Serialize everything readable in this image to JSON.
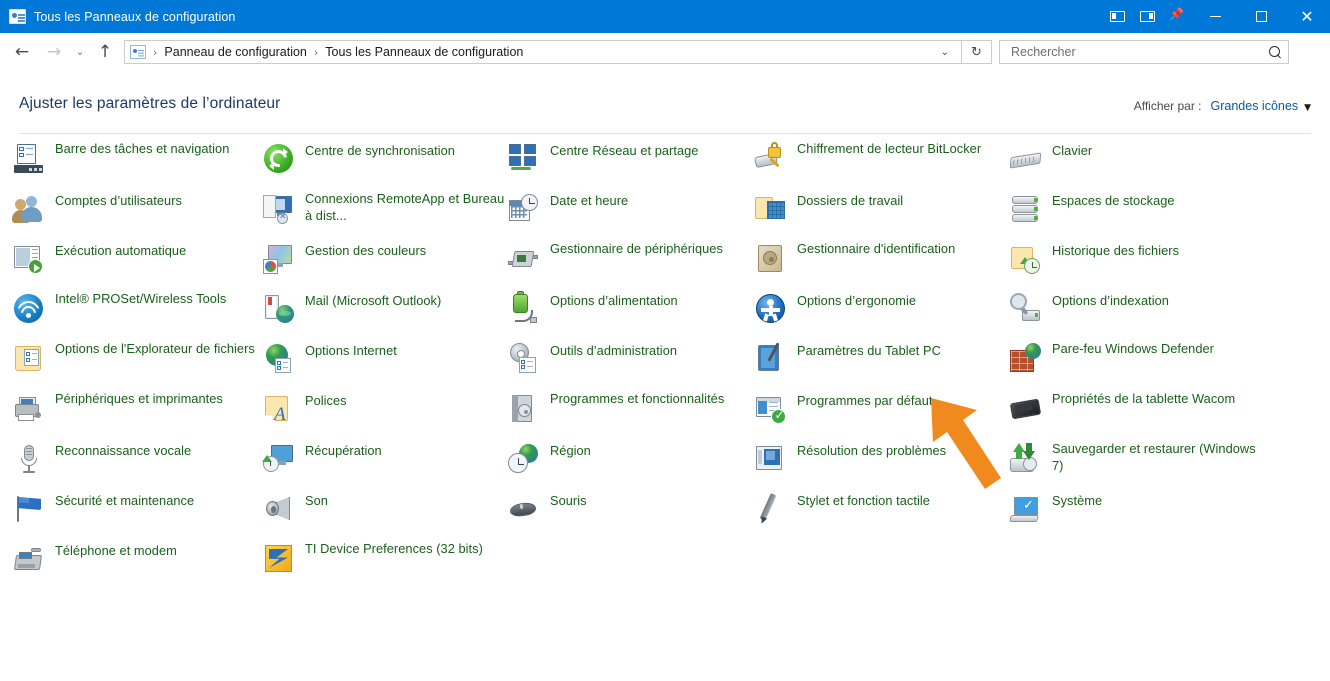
{
  "window": {
    "title": "Tous les Panneaux de configuration",
    "app_icon": "control-panel-icon",
    "tools": [
      {
        "name": "dock-left-icon",
        "label": "Volet gauche"
      },
      {
        "name": "dock-right-icon",
        "label": "Volet droit"
      },
      {
        "name": "pin-icon",
        "label": "Épingler"
      }
    ],
    "minimize": "—",
    "maximize": "□",
    "close": "✕"
  },
  "nav": {
    "back": "←",
    "forward": "→",
    "recent": "⌄",
    "up": "↑"
  },
  "address": {
    "icon": "control-panel-icon",
    "crumbs": [
      "Panneau de configuration",
      "Tous les Panneaux de configuration"
    ],
    "separator": "›",
    "dropdown_caret": "⌄",
    "refresh": "↻"
  },
  "search": {
    "placeholder": "Rechercher",
    "value": "",
    "icon": "search-icon"
  },
  "header": {
    "page_title": "Ajuster les paramètres de l’ordinateur",
    "view_by_label": "Afficher par :",
    "view_by_value": "Grandes icônes",
    "view_by_caret": "▼"
  },
  "colors": {
    "titlebar": "#0078d7",
    "link": "#19601a",
    "page_title": "#1f3864",
    "view_by_value": "#0a5a9c",
    "cursor_arrow": "#f08a1e"
  },
  "columns": [
    {
      "items": [
        {
          "label": "Barre des tâches et navigation",
          "icon": "taskbar-navigation-icon",
          "row": 0,
          "lines": 2
        },
        {
          "label": "Comptes d’utilisateurs",
          "icon": "user-accounts-icon",
          "row": 1,
          "lines": 1
        },
        {
          "label": "Exécution automatique",
          "icon": "autoplay-icon",
          "row": 2,
          "lines": 1
        },
        {
          "label": "Intel® PROSet/Wireless Tools",
          "icon": "intel-wireless-icon",
          "row": 3,
          "lines": 2
        },
        {
          "label": "Options de l'Explorateur de fichiers",
          "icon": "file-explorer-options-icon",
          "row": 4,
          "lines": 2
        },
        {
          "label": "Périphériques et imprimantes",
          "icon": "devices-printers-icon",
          "row": 5,
          "lines": 2
        },
        {
          "label": "Reconnaissance vocale",
          "icon": "speech-recognition-icon",
          "row": 6,
          "lines": 1
        },
        {
          "label": "Sécurité et maintenance",
          "icon": "security-maintenance-icon",
          "row": 7,
          "lines": 1
        },
        {
          "label": "Téléphone et modem",
          "icon": "phone-modem-icon",
          "row": 8,
          "lines": 1
        }
      ]
    },
    {
      "items": [
        {
          "label": "Centre de synchronisation",
          "icon": "sync-center-icon",
          "row": 0,
          "lines": 1
        },
        {
          "label": "Connexions RemoteApp et Bureau à dist...",
          "icon": "remoteapp-icon",
          "row": 1,
          "lines": 2
        },
        {
          "label": "Gestion des couleurs",
          "icon": "color-management-icon",
          "row": 2,
          "lines": 1
        },
        {
          "label": "Mail (Microsoft Outlook)",
          "icon": "mail-outlook-icon",
          "row": 3,
          "lines": 1
        },
        {
          "label": "Options Internet",
          "icon": "internet-options-icon",
          "row": 4,
          "lines": 1
        },
        {
          "label": "Polices",
          "icon": "fonts-icon",
          "row": 5,
          "lines": 1
        },
        {
          "label": "Récupération",
          "icon": "recovery-icon",
          "row": 6,
          "lines": 1
        },
        {
          "label": "Son",
          "icon": "sound-icon",
          "row": 7,
          "lines": 1
        },
        {
          "label": "TI Device Preferences (32 bits)",
          "icon": "ti-device-preferences-icon",
          "row": 8,
          "lines": 2
        }
      ]
    },
    {
      "items": [
        {
          "label": "Centre Réseau et partage",
          "icon": "network-sharing-center-icon",
          "row": 0,
          "lines": 1
        },
        {
          "label": "Date et heure",
          "icon": "date-time-icon",
          "row": 1,
          "lines": 1
        },
        {
          "label": "Gestionnaire de périphériques",
          "icon": "device-manager-icon",
          "row": 2,
          "lines": 2
        },
        {
          "label": "Options d’alimentation",
          "icon": "power-options-icon",
          "row": 3,
          "lines": 1
        },
        {
          "label": "Outils d’administration",
          "icon": "administrative-tools-icon",
          "row": 4,
          "lines": 1
        },
        {
          "label": "Programmes et fonctionnalités",
          "icon": "programs-features-icon",
          "row": 5,
          "lines": 2
        },
        {
          "label": "Région",
          "icon": "region-icon",
          "row": 6,
          "lines": 1
        },
        {
          "label": "Souris",
          "icon": "mouse-icon",
          "row": 7,
          "lines": 1
        }
      ]
    },
    {
      "items": [
        {
          "label": "Chiffrement de lecteur BitLocker",
          "icon": "bitlocker-icon",
          "row": 0,
          "lines": 2
        },
        {
          "label": "Dossiers de travail",
          "icon": "work-folders-icon",
          "row": 1,
          "lines": 1
        },
        {
          "label": "Gestionnaire d'identification",
          "icon": "credential-manager-icon",
          "row": 2,
          "lines": 2
        },
        {
          "label": "Options d’ergonomie",
          "icon": "ease-of-access-icon",
          "row": 3,
          "lines": 1
        },
        {
          "label": "Paramètres du Tablet PC",
          "icon": "tablet-pc-settings-icon",
          "row": 4,
          "lines": 1
        },
        {
          "label": "Programmes par défaut",
          "icon": "default-programs-icon",
          "row": 5,
          "lines": 1
        },
        {
          "label": "Résolution des problèmes",
          "icon": "troubleshooting-icon",
          "row": 6,
          "lines": 1
        },
        {
          "label": "Stylet et fonction tactile",
          "icon": "pen-touch-icon",
          "row": 7,
          "lines": 1
        }
      ]
    },
    {
      "items": [
        {
          "label": "Clavier",
          "icon": "keyboard-icon",
          "row": 0,
          "lines": 1
        },
        {
          "label": "Espaces de stockage",
          "icon": "storage-spaces-icon",
          "row": 1,
          "lines": 1
        },
        {
          "label": "Historique des fichiers",
          "icon": "file-history-icon",
          "row": 2,
          "lines": 1
        },
        {
          "label": "Options d’indexation",
          "icon": "indexing-options-icon",
          "row": 3,
          "lines": 1
        },
        {
          "label": "Pare-feu Windows Defender",
          "icon": "windows-defender-firewall-icon",
          "row": 4,
          "lines": 2
        },
        {
          "label": "Propriétés de la tablette Wacom",
          "icon": "wacom-tablet-icon",
          "row": 5,
          "lines": 2
        },
        {
          "label": "Sauvegarder et restaurer (Windows 7)",
          "icon": "backup-restore-icon",
          "row": 6,
          "lines": 2
        },
        {
          "label": "Système",
          "icon": "system-icon",
          "row": 7,
          "lines": 1
        }
      ]
    }
  ],
  "cursor": {
    "type": "arrow-pointer-annotation",
    "color": "#f08a1e",
    "points_to": "Paramètres du Tablet PC"
  }
}
